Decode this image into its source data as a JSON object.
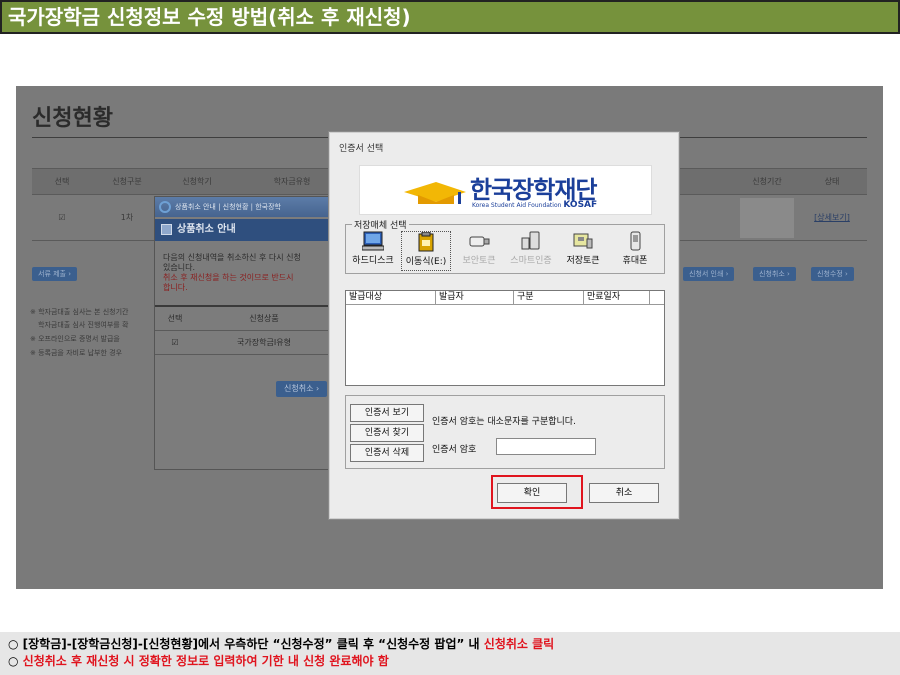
{
  "slide": {
    "title": "국가장학금 신청정보 수정 방법(취소 후 재신청)",
    "bullets": [
      {
        "prefix": "○ [장학금]-[장학금신청]-[신청현황]에서 우측하단 “신청수정” 클릭 후 “신청수정 팝업” 내 ",
        "highlight": "신청취소 클릭"
      },
      {
        "prefix": "○ ",
        "highlight": "신청취소 후 재신청 시 정확한 정보로 입력하여 기한 내 신청 완료해야 함"
      }
    ]
  },
  "background_page": {
    "heading": "신청현황",
    "columns": [
      "선택",
      "신청구분",
      "신청학기",
      "학자금유형",
      "신청기간",
      "상태"
    ],
    "row": {
      "check": "☑",
      "kind": "1차",
      "status_link": "[상세보기]"
    },
    "left_button": "서류 제출 ›",
    "right_buttons": [
      "신청서 인쇄 ›",
      "신청취소 ›",
      "신청수정 ›"
    ],
    "notes": [
      "※ 학자금대출 심사는 본 신청기간",
      "학자금대출 심사 진행여부를 확",
      "※ 오프라인으로 증명서 발급을",
      "※ 등록금을 자비로 납부한 경우"
    ]
  },
  "cancel_popup": {
    "window_title": "상품취소 안내 | 신청현황 | 한국장학",
    "header": "상품취소 안내",
    "text_lines": [
      "다음의 신청내역을 취소하신 후 다시 신청",
      "있습니다."
    ],
    "warning_lines": [
      "취소 후 재신청을 하는 것이므로 반드시",
      "합니다."
    ],
    "columns": [
      "선택",
      "신청상품"
    ],
    "row": {
      "check": "☑",
      "product": "국가장학금I유형"
    },
    "button": "신청취소 ›"
  },
  "cert_dialog": {
    "title": "인증서 선택",
    "logo_text": "한국장학재단",
    "logo_sub": "Korea Student Aid Foundation",
    "logo_abbr": "KOSAF",
    "media_legend": "저장매체 선택",
    "media": [
      {
        "label": "하드디스크",
        "icon": "hard-disk-icon",
        "enabled": true,
        "selected": false
      },
      {
        "label": "이동식(E:)",
        "icon": "removable-drive-icon",
        "enabled": true,
        "selected": true
      },
      {
        "label": "보안토큰",
        "icon": "security-token-icon",
        "enabled": false,
        "selected": false
      },
      {
        "label": "스마트인증",
        "icon": "smart-cert-icon",
        "enabled": false,
        "selected": false
      },
      {
        "label": "저장토큰",
        "icon": "storage-token-icon",
        "enabled": true,
        "selected": false
      },
      {
        "label": "휴대폰",
        "icon": "mobile-phone-icon",
        "enabled": true,
        "selected": false
      }
    ],
    "list_columns": [
      "발급대상",
      "발급자",
      "구분",
      "만료일자"
    ],
    "buttons": {
      "view": "인증서 보기",
      "find": "인증서 찾기",
      "delete": "인증서 삭제",
      "ok": "확인",
      "cancel": "취소"
    },
    "password_note": "인증서 암호는 대소문자를 구분합니다.",
    "password_label": "인증서 암호",
    "highlight_color": "#e0141e"
  }
}
